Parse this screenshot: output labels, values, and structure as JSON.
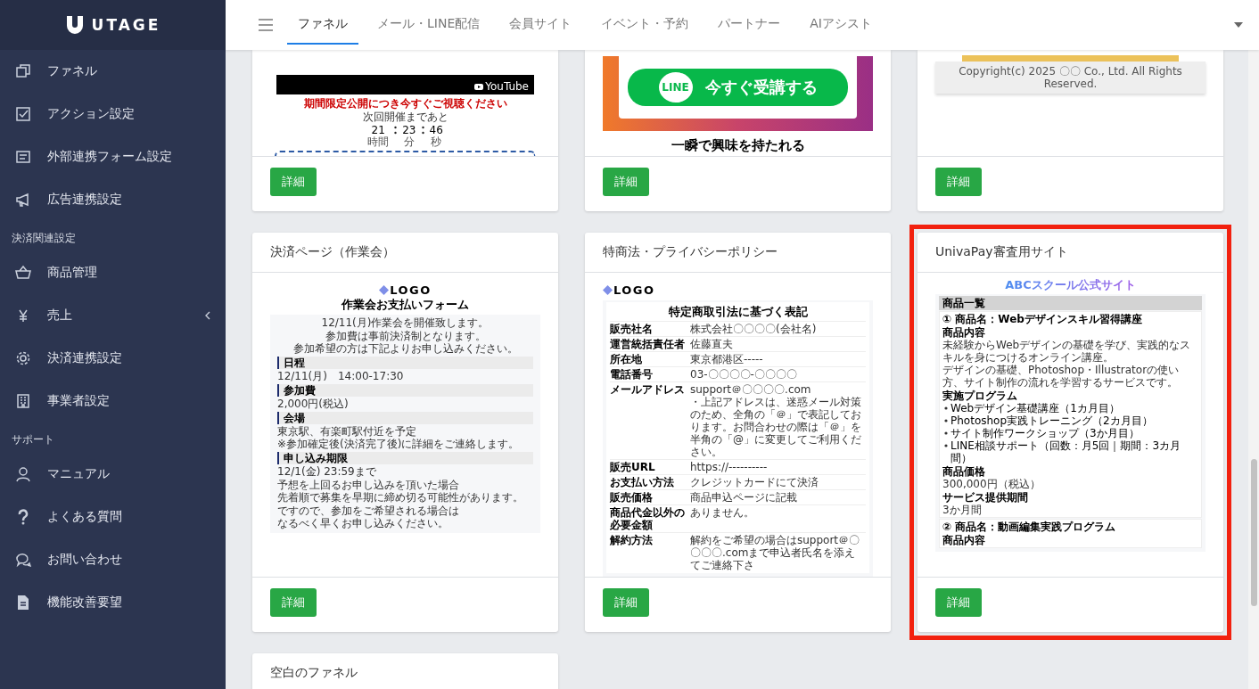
{
  "sidebar": {
    "logo": "UTAGE",
    "groups": [
      {
        "items": [
          {
            "label": "ファネル"
          },
          {
            "label": "アクション設定"
          },
          {
            "label": "外部連携フォーム設定"
          },
          {
            "label": "広告連携設定"
          }
        ]
      },
      {
        "heading": "決済関連設定",
        "items": [
          {
            "label": "商品管理"
          },
          {
            "label": "売上",
            "expanded": false
          },
          {
            "label": "決済連携設定"
          },
          {
            "label": "事業者設定"
          }
        ]
      },
      {
        "heading": "サポート",
        "items": [
          {
            "label": "マニュアル"
          },
          {
            "label": "よくある質問"
          },
          {
            "label": "お問い合わせ"
          },
          {
            "label": "機能改善要望"
          }
        ]
      }
    ]
  },
  "nav": {
    "tabs": [
      {
        "label": "ファネル",
        "selected": true
      },
      {
        "label": "メール・LINE配信",
        "selected": false
      },
      {
        "label": "会員サイト",
        "selected": false
      },
      {
        "label": "イベント・予約",
        "selected": false
      },
      {
        "label": "パートナー",
        "selected": false
      },
      {
        "label": "AIアシスト",
        "selected": false
      }
    ]
  },
  "cards": [
    {
      "preview": {
        "blocks": [
          {
            "kind": "video",
            "label": "YouTube"
          },
          {
            "kind": "alert",
            "text": "期間限定公開につき今すぐご視聴ください"
          },
          {
            "kind": "center-text",
            "lines": [
              "次回開催まであと"
            ]
          },
          {
            "kind": "countdown",
            "values": [
              "21",
              "23",
              "46"
            ],
            "units": [
              "時間",
              "分",
              "秒"
            ]
          },
          {
            "kind": "dashed-box"
          }
        ]
      },
      "button": "詳細",
      "highlighted": false
    },
    {
      "preview": {
        "blocks": [
          {
            "kind": "cta",
            "icon_label": "LINE",
            "label": "今すぐ受講する"
          },
          {
            "kind": "heading-lg",
            "text": "一瞬で興味を持たれる"
          }
        ]
      },
      "button": "詳細",
      "highlighted": false
    },
    {
      "preview": {
        "blocks": [
          {
            "kind": "order-bar"
          },
          {
            "kind": "footer-bar",
            "text": "Copyright(c) 2025 〇〇 Co., Ltd. All Rights Reserved."
          }
        ]
      },
      "button": "詳細",
      "highlighted": false
    },
    {
      "title": "決済ページ（作業会）",
      "preview": {
        "blocks": [
          {
            "kind": "logo",
            "text": "LOGO"
          },
          {
            "kind": "title",
            "text": "作業会お支払いフォーム"
          },
          {
            "kind": "panel",
            "children": [
              {
                "kind": "center-text",
                "lines": [
                  "12/11(月)作業会を開催致します。"
                ]
              },
              {
                "kind": "center-text",
                "lines": [
                  "参加費は事前決済制となります。",
                  "参加希望の方は下記よりお申し込みください。"
                ]
              },
              {
                "kind": "section",
                "text": "日程"
              },
              {
                "kind": "text",
                "lines": [
                  "12/11(月)　14:00-17:30"
                ]
              },
              {
                "kind": "section",
                "text": "参加費"
              },
              {
                "kind": "text",
                "lines": [
                  "2,000円(税込)"
                ]
              },
              {
                "kind": "section",
                "text": "会場"
              },
              {
                "kind": "text",
                "lines": [
                  "東京駅、有楽町駅付近を予定",
                  "※参加確定後(決済完了後)に詳細をご連絡します。"
                ]
              },
              {
                "kind": "section",
                "text": "申し込み期限"
              },
              {
                "kind": "text",
                "lines": [
                  "12/1(金) 23:59まで"
                ]
              },
              {
                "kind": "text",
                "lines": [
                  "予想を上回るお申し込みを頂いた場合",
                  "先着順で募集を早期に締め切る可能性があります。"
                ]
              },
              {
                "kind": "text",
                "lines": [
                  "ですので、参加をご希望される場合は",
                  "なるべく早くお申し込みください。"
                ]
              }
            ]
          }
        ]
      },
      "button": "詳細",
      "highlighted": false
    },
    {
      "title": "特商法・プライバシーポリシー",
      "preview": {
        "blocks": [
          {
            "kind": "header-logo",
            "text": "LOGO"
          },
          {
            "kind": "panel",
            "children": [
              {
                "kind": "sheet",
                "children": [
                  {
                    "kind": "title",
                    "text": "特定商取引法に基づく表記"
                  },
                  {
                    "kind": "row",
                    "label": "販売社名",
                    "values": [
                      "株式会社〇〇〇〇(会社名)"
                    ]
                  },
                  {
                    "kind": "row",
                    "label": "運営統括責任者",
                    "values": [
                      "佐藤直夫"
                    ]
                  },
                  {
                    "kind": "row",
                    "label": "所在地",
                    "values": [
                      "東京都港区-----"
                    ]
                  },
                  {
                    "kind": "row",
                    "label": "電話番号",
                    "values": [
                      "03-〇〇〇〇-〇〇〇〇"
                    ]
                  },
                  {
                    "kind": "row",
                    "label": "メールアドレス",
                    "values": [
                      "support＠〇〇〇〇.com",
                      "・上記アドレスは、迷惑メール対策のため、全角の「＠」で表記しております。お問合わせの際は「＠」を半角の「@」に変更してご利用ください。"
                    ]
                  },
                  {
                    "kind": "row",
                    "label": "販売URL",
                    "values": [
                      "https://----------"
                    ]
                  },
                  {
                    "kind": "row",
                    "label": "お支払い方法",
                    "values": [
                      "クレジットカードにて決済"
                    ]
                  },
                  {
                    "kind": "row",
                    "label": "販売価格",
                    "values": [
                      "商品申込ページに記載"
                    ]
                  },
                  {
                    "kind": "row",
                    "label": "商品代金以外の必要金額",
                    "values": [
                      "ありません。"
                    ]
                  },
                  {
                    "kind": "row",
                    "label": "解約方法",
                    "values": [
                      "解約をご希望の場合はsupport＠〇〇〇〇.comまで申込者氏名を添えてご連絡下さ"
                    ]
                  }
                ]
              }
            ]
          }
        ]
      },
      "button": "詳細",
      "highlighted": false
    },
    {
      "title": "UnivaPay審査用サイト",
      "preview": {
        "blocks": [
          {
            "kind": "site-title",
            "text": "ABCスクール公式サイト"
          },
          {
            "kind": "panel",
            "children": [
              {
                "kind": "bar",
                "text": "商品一覧"
              },
              {
                "kind": "product",
                "title": "① 商品名：Webデザインスキル習得講座",
                "children": [
                  {
                    "kind": "subheading",
                    "text": "商品内容"
                  },
                  {
                    "kind": "text",
                    "lines": [
                      "未経験からWebデザインの基礎を学び、実践的なスキルを身につけるオンライン講座。",
                      "デザインの基礎、Photoshop・Illustratorの使い方、サイト制作の流れを学習するサービスです。"
                    ]
                  },
                  {
                    "kind": "subheading",
                    "text": "実施プログラム"
                  },
                  {
                    "kind": "bullets",
                    "items": [
                      "Webデザイン基礎講座（1カ月目）",
                      "Photoshop実践トレーニング（2カ月目）",
                      "サイト制作ワークショップ（3か月目）",
                      "LINE相談サポート（回数：月5回｜期間：3カ月間）"
                    ]
                  },
                  {
                    "kind": "subheading",
                    "text": "商品価格"
                  },
                  {
                    "kind": "text",
                    "lines": [
                      "300,000円（税込）"
                    ]
                  },
                  {
                    "kind": "subheading",
                    "text": "サービス提供期間"
                  },
                  {
                    "kind": "text",
                    "lines": [
                      "3か月間"
                    ]
                  }
                ]
              },
              {
                "kind": "product",
                "title": "② 商品名：動画編集実践プログラム",
                "children": [
                  {
                    "kind": "subheading",
                    "text": "商品内容"
                  }
                ]
              }
            ]
          }
        ]
      },
      "button": "詳細",
      "highlighted": true
    },
    {
      "title": "空白のファネル",
      "highlighted": false
    }
  ]
}
